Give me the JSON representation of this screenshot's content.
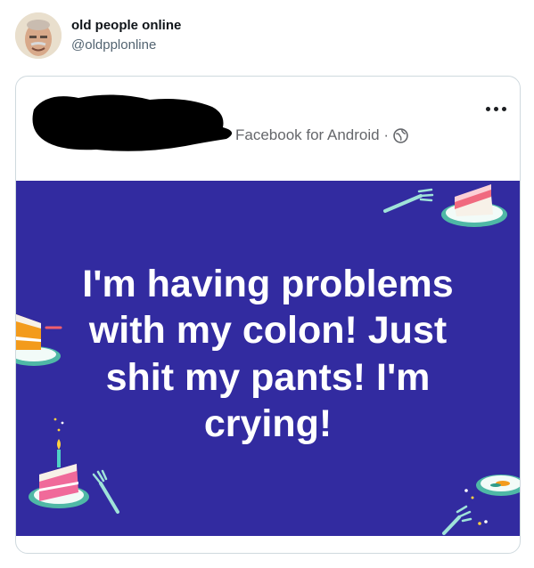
{
  "tweet": {
    "display_name": "old people online",
    "handle": "@oldpplonline"
  },
  "facebook_post": {
    "source": "Facebook for Android ·",
    "text": "I'm having problems with my colon! Just shit my pants! I'm crying!",
    "background_color": "#322ba0"
  },
  "icons": [
    "avatar-photo",
    "more-options-icon",
    "globe-icon",
    "cake-slice-icon",
    "fork-icon",
    "candle-icon"
  ]
}
